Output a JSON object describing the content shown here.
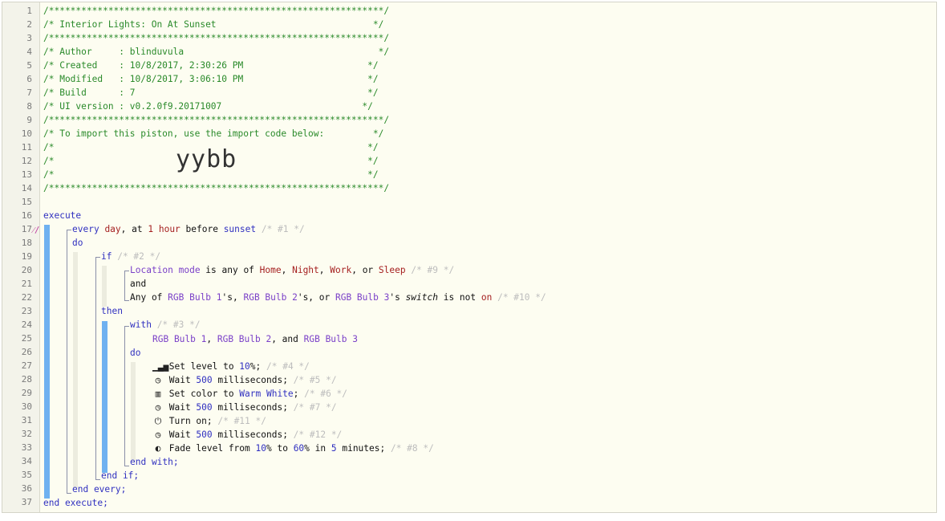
{
  "header": {
    "border": "/**************************************************************/",
    "title": "/* Interior Lights: On At Sunset                             */",
    "author": "/* Author     : blinduvula                                    */",
    "created": "/* Created    : 10/8/2017, 2:30:26 PM                       */",
    "modified": "/* Modified   : 10/8/2017, 3:06:10 PM                       */",
    "build": "/* Build      : 7                                           */",
    "ui_version": "/* UI version : v0.2.0f9.20171007                          */",
    "import_note": "/* To import this piston, use the import code below:         */",
    "blank_comment": "/*                                                          */",
    "import_code": "yybb"
  },
  "code": {
    "execute": "execute",
    "every": "every",
    "day": "day",
    "at": ", at ",
    "one": "1",
    "hour": "hour",
    "before": " before ",
    "sunset": "sunset",
    "c1": " /* #1 */",
    "do": "do",
    "if": "if",
    "c2": " /* #2 */",
    "location_mode": "Location mode",
    "is_any_of": " is any of ",
    "home": "Home",
    "night": "Night",
    "work": "Work",
    "or": ", or ",
    "sleep": "Sleep",
    "c9": " /* #9 */",
    "and": "and",
    "any_of": "Any of ",
    "bulb1": "RGB Bulb 1",
    "bulb2": "RGB Bulb 2",
    "bulb3": "RGB Bulb 3",
    "s_comma": "'s, ",
    "s_comma_or": "'s, or ",
    "s": "'s ",
    "switch": "switch",
    "is_not": " is not ",
    "on": "on",
    "c10": " /* #10 */",
    "then": "then",
    "with": "with",
    "c3": " /* #3 */",
    "comma": ", ",
    "comma_and": ", and ",
    "set_level_to": " Set level to ",
    "ten": "10",
    "pct_semi": "%;",
    "c4": " /* #4 */",
    "wait": " Wait ",
    "five_hundred": "500",
    "ms": " milliseconds;",
    "c5": " /* #5 */",
    "set_color_to": " Set color to ",
    "warm_white": "Warm White",
    "semi": ";",
    "c6": " /* #6 */",
    "c7": " /* #7 */",
    "turn_on": " Turn on;",
    "c11": " /* #11 */",
    "c12": " /* #12 */",
    "fade_from": " Fade level from ",
    "pct_to": "% to ",
    "sixty": "60",
    "pct_in": "% in ",
    "five": "5",
    "minutes": " minutes;",
    "c8": " /* #8 */",
    "end_with": "end with;",
    "end_if": "end if;",
    "end_every": "end every;",
    "end_execute": "end execute;",
    "trigger_marker": "⁄/"
  },
  "icons": {
    "set_level": "signal-bars-icon",
    "wait": "clock-icon",
    "set_color": "color-gradient-icon",
    "turn_on": "power-icon",
    "fade": "half-circle-icon"
  },
  "colors": {
    "comment": "#2a8a2a",
    "keyword": "#3030c0",
    "value": "#a52020",
    "device": "#7a40c8",
    "note": "#bdbdbd",
    "block_bar": "#6fb1f0"
  },
  "line_numbers": [
    "1",
    "2",
    "3",
    "4",
    "5",
    "6",
    "7",
    "8",
    "9",
    "10",
    "11",
    "12",
    "13",
    "14",
    "15",
    "16",
    "17",
    "18",
    "19",
    "20",
    "21",
    "22",
    "23",
    "24",
    "25",
    "26",
    "27",
    "28",
    "29",
    "30",
    "31",
    "32",
    "33",
    "34",
    "35",
    "36",
    "37"
  ]
}
